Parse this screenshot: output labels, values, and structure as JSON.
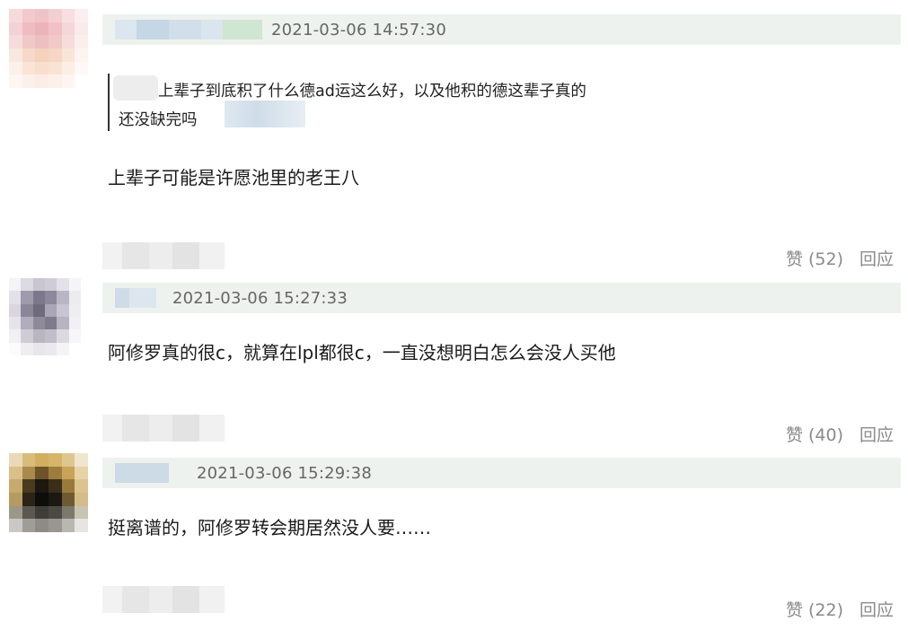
{
  "comments": [
    {
      "timestamp": "2021-03-06 14:57:30",
      "quote_line1": "上辈子到底积了什么德ad运这么好，以及他积的德这辈子真的",
      "quote_line2": "还没缺完吗",
      "body": "上辈子可能是许愿池里的老王八",
      "like_label": "赞 (52)",
      "reply_label": "回应"
    },
    {
      "timestamp": "2021-03-06 15:27:33",
      "body": "阿修罗真的很c，就算在lpl都很c，一直没想明白怎么会没人买他",
      "like_label": "赞 (40)",
      "reply_label": "回应"
    },
    {
      "timestamp": "2021-03-06 15:29:38",
      "body": "挺离谱的，阿修罗转会期居然没人要……",
      "like_label": "赞 (22)",
      "reply_label": "回应"
    }
  ],
  "colors": {
    "header_bg": "#eef2ef",
    "timestamp": "#666666",
    "action": "#8a8a8a"
  }
}
